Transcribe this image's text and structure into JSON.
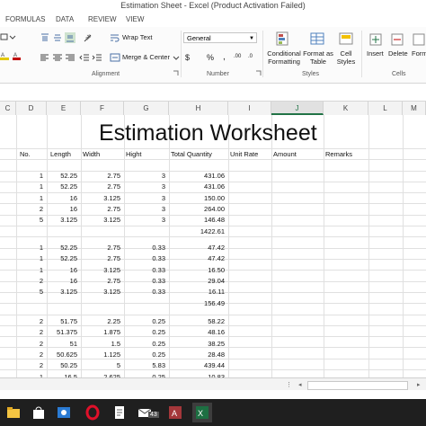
{
  "window": {
    "title": "Estimation Sheet - Excel (Product Activation Failed)"
  },
  "ribbon_tabs": [
    "FORMULAS",
    "DATA",
    "REVIEW",
    "VIEW"
  ],
  "ribbon": {
    "wrap_text": "Wrap Text",
    "merge_center": "Merge & Center",
    "number_format": "General",
    "dollar": "$",
    "percent": "%",
    "comma": ",",
    "dec_inc": ".00",
    "dec_dec": ".0",
    "cond_fmt": [
      "Conditional",
      "Formatting"
    ],
    "fmt_table": [
      "Format as",
      "Table"
    ],
    "cell_styles": [
      "Cell",
      "Styles"
    ],
    "insert": "Insert",
    "delete": "Delete",
    "format": "Forma",
    "groups": {
      "alignment": "Alignment",
      "number": "Number",
      "styles": "Styles",
      "cells": "Cells"
    }
  },
  "columns": [
    "C",
    "D",
    "E",
    "F",
    "G",
    "H",
    "I",
    "J",
    "K",
    "L",
    "M"
  ],
  "selected_column": "J",
  "sheet": {
    "title": "Estimation Worksheet",
    "headers": [
      "No.",
      "Length",
      "Width",
      "Hight",
      "Total Quantity",
      "Unit Rate",
      "Amount",
      "Remarks"
    ],
    "block1": [
      [
        "1",
        "52.25",
        "2.75",
        "3",
        "431.06"
      ],
      [
        "1",
        "52.25",
        "2.75",
        "3",
        "431.06"
      ],
      [
        "1",
        "16",
        "3.125",
        "3",
        "150.00"
      ],
      [
        "2",
        "16",
        "2.75",
        "3",
        "264.00"
      ],
      [
        "5",
        "3.125",
        "3.125",
        "3",
        "146.48"
      ]
    ],
    "block1_total": "1422.61",
    "block2": [
      [
        "1",
        "52.25",
        "2.75",
        "0.33",
        "47.42"
      ],
      [
        "1",
        "52.25",
        "2.75",
        "0.33",
        "47.42"
      ],
      [
        "1",
        "16",
        "3.125",
        "0.33",
        "16.50"
      ],
      [
        "2",
        "16",
        "2.75",
        "0.33",
        "29.04"
      ],
      [
        "5",
        "3.125",
        "3.125",
        "0.33",
        "16.11"
      ]
    ],
    "block2_total": "156.49",
    "block3": [
      [
        "2",
        "51.75",
        "2.25",
        "0.25",
        "58.22"
      ],
      [
        "2",
        "51.375",
        "1.875",
        "0.25",
        "48.16"
      ],
      [
        "2",
        "51",
        "1.5",
        "0.25",
        "38.25"
      ],
      [
        "2",
        "50.625",
        "1.125",
        "0.25",
        "28.48"
      ],
      [
        "2",
        "50.25",
        "5",
        "5.83",
        "439.44"
      ],
      [
        "1",
        "16.5",
        "2.625",
        "0.25",
        "10.83"
      ]
    ]
  },
  "taskbar": {
    "badge": "43",
    "icons": [
      "file-explorer-icon",
      "store-icon",
      "media-icon",
      "opera-icon",
      "document-icon",
      "mail-icon",
      "access-icon",
      "excel-icon"
    ]
  }
}
